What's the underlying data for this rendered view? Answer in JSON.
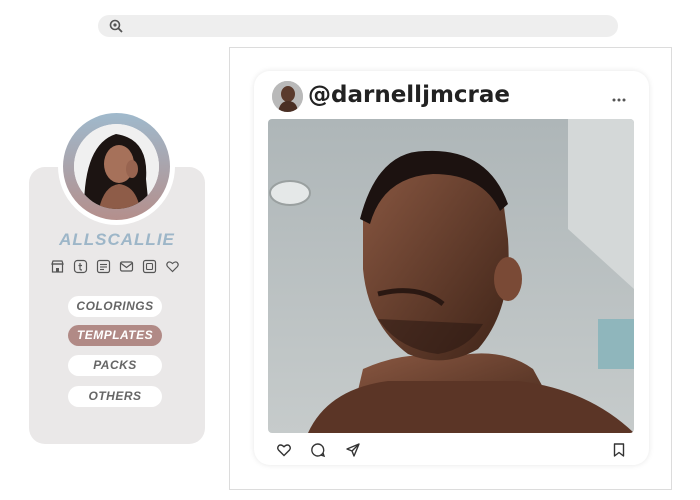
{
  "search": {
    "icon": "search-icon",
    "value": ""
  },
  "profile": {
    "username": "ALLSCALLIE",
    "avatar_icon": "avatar",
    "social_icons": [
      "shop-icon",
      "tumblr-icon",
      "message-icon",
      "mail-icon",
      "instagram-icon",
      "heart-icon"
    ]
  },
  "nav": {
    "items": [
      {
        "label": "COLORINGS",
        "active": false
      },
      {
        "label": "TEMPLATES",
        "active": true
      },
      {
        "label": "PACKS",
        "active": false
      },
      {
        "label": "OTHERS",
        "active": false
      }
    ]
  },
  "post": {
    "username": "@darnelljmcrae",
    "menu_icon": "more-icon",
    "actions": [
      "heart-icon",
      "comment-icon",
      "share-icon",
      "bookmark-icon"
    ]
  },
  "colors": {
    "accent": "#b18a86",
    "username": "#9db6c8",
    "panel": "#eae8e8"
  }
}
